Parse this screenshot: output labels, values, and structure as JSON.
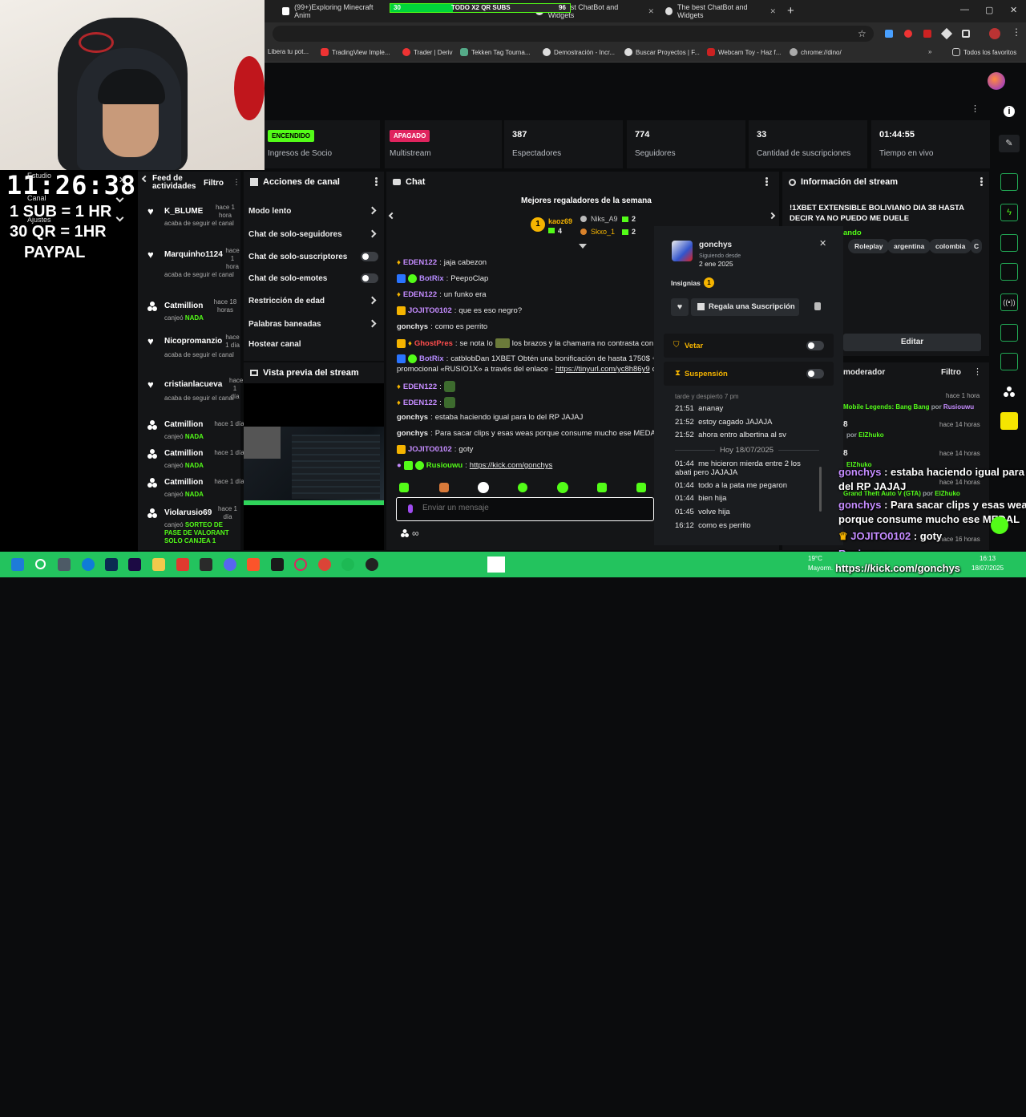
{
  "browser": {
    "tabs": [
      {
        "label": "(99+)Exploring Minecraft Anim"
      },
      {
        "label": "The best ChatBot and Widgets"
      },
      {
        "label": "The best ChatBot and Widgets"
      }
    ],
    "bookmarks": [
      "Libera tu pot...",
      "TradingView Imple...",
      "Trader | Deriv",
      "Tekken Tag Tourna...",
      "Demostración - Incr...",
      "Buscar Proyectos | F...",
      "Webcam Toy - Haz f...",
      "chrome://dino/",
      "Todos los favoritos"
    ]
  },
  "stats": [
    {
      "badge": "ENCENDIDO",
      "label": "Ingresos de Socio"
    },
    {
      "badge": "APAGADO",
      "label": "Multistream"
    },
    {
      "value": "387",
      "label": "Espectadores"
    },
    {
      "value": "774",
      "label": "Seguidores"
    },
    {
      "value": "33",
      "label": "Cantidad de suscripciones"
    },
    {
      "value": "01:44:55",
      "label": "Tiempo en vivo"
    }
  ],
  "feed": {
    "title": "Feed de actividades",
    "filter": "Filtro",
    "items": [
      {
        "name": "K_BLUME",
        "time": "hace 1 hora",
        "desc": "acaba de seguir el canal"
      },
      {
        "name": "Marquinho1124",
        "time": "hace 1 hora",
        "desc": "acaba de seguir el canal"
      },
      {
        "name": "Catmillion",
        "time": "hace 18 horas",
        "desc": "canjeó",
        "reward": "NADA"
      },
      {
        "name": "Nicopromanzio",
        "time": "hace 1 día",
        "desc": "acaba de seguir el canal"
      },
      {
        "name": "cristianlacueva",
        "time": "hace 1 día",
        "desc": "acaba de seguir el canal"
      },
      {
        "name": "Catmillion",
        "time": "hace 1 día",
        "desc": "canjeó",
        "reward": "NADA"
      },
      {
        "name": "Catmillion",
        "time": "hace 1 día",
        "desc": "canjeó",
        "reward": "NADA"
      },
      {
        "name": "Catmillion",
        "time": "hace 1 día",
        "desc": "canjeó",
        "reward": "NADA"
      },
      {
        "name": "Violarusio69",
        "time": "hace 1 día",
        "desc": "canjeó",
        "reward": "SORTEO DE PASE DE VALORANT SOLO CANJEA 1"
      }
    ]
  },
  "actions": {
    "title": "Acciones de canal",
    "items": [
      "Modo lento",
      "Chat de solo-seguidores",
      "Chat de solo-suscriptores",
      "Chat de solo-emotes",
      "Restricción de edad",
      "Palabras baneadas",
      "Hostear canal"
    ],
    "preview_title": "Vista previa del stream"
  },
  "chat": {
    "title": "Chat",
    "gifters_title": "Mejores regaladores de la semana",
    "gifters": [
      {
        "rank": "1",
        "name": "kaoz69",
        "count": "4"
      },
      {
        "name": "Niks_A9",
        "count": "2"
      },
      {
        "name": "Skxo_1",
        "count": "2"
      }
    ],
    "messages": [
      {
        "user": "EDEN122",
        "text": "jaja cabezon",
        "color": "#c58cff"
      },
      {
        "user": "BotRix",
        "text": "PeepoClap",
        "color": "#b68cff"
      },
      {
        "user": "EDEN122",
        "text": "un funko era",
        "color": "#c58cff"
      },
      {
        "user": "JOJITO0102",
        "text": "que es eso negro?",
        "color": "#c58cff"
      },
      {
        "user": "gonchys",
        "text": "como es perrito",
        "color": "#e8e8e8"
      },
      {
        "user": "GhostPres",
        "text": "se nota lo",
        "text2": "los brazos y la chamarra no contrasta con tu",
        "color": "#ff4d4d"
      },
      {
        "user": "BotRix",
        "text": "catblobDan 1XBET Obtén una bonificación de hasta 1750$ + 150",
        "line2": "promocional «RUSIO1X» a través del enlace -",
        "link": "https://tinyurl.com/yc8h86y9",
        "tail": "cat",
        "color": "#b68cff"
      },
      {
        "user": "EDEN122",
        "text": "",
        "color": "#c58cff"
      },
      {
        "user": "EDEN122",
        "text": "",
        "color": "#c58cff"
      },
      {
        "user": "gonchys",
        "text": "estaba haciendo igual para lo del RP JAJAJ",
        "color": "#e8e8e8"
      },
      {
        "user": "gonchys",
        "text": "Para sacar clips y esas weas porque consume mucho ese MEDAL",
        "color": "#e8e8e8"
      },
      {
        "user": "JOJITO0102",
        "text": "goty",
        "color": "#c58cff"
      },
      {
        "user": "Rusiouwu",
        "text": "",
        "link": "https://kick.com/gonchys",
        "color": "#53fc18"
      }
    ],
    "input_placeholder": "Enviar un mensaje"
  },
  "user_card": {
    "name": "gonchys",
    "following_label": "Siguiendo desde",
    "following_date": "2 ene 2025",
    "insignias_label": "Insignias",
    "insignias_count": "1",
    "gift_label": "Regala una Suscripción",
    "veto_label": "Vetar",
    "suspend_label": "Suspensión",
    "history_partial": "tarde y despierto 7 pm",
    "history": [
      {
        "time": "21:51",
        "text": "ananay"
      },
      {
        "time": "21:52",
        "text": "estoy cagado JAJAJA"
      },
      {
        "time": "21:52",
        "text": "ahora entro albertina al sv"
      },
      {
        "divider": "Hoy 18/07/2025"
      },
      {
        "time": "01:44",
        "text": "me hicieron mierda entre 2 los",
        "text2": "abati pero JAJAJA"
      },
      {
        "time": "01:44",
        "text": "todo a la pata me pegaron"
      },
      {
        "time": "01:44",
        "text": "bien hija"
      },
      {
        "time": "01:45",
        "text": "volve hija"
      },
      {
        "time": "16:12",
        "text": "como es perrito"
      }
    ]
  },
  "stream_info": {
    "title": "Información del stream",
    "stream_title": "!1XBET EXTENSIBLE BOLIVIANO DIA 38 HASTA DECIR YA NO PUEDO ME DUELE",
    "category_partial": "ando",
    "tags": [
      "Roleplay",
      "argentina",
      "colombia",
      "C"
    ],
    "edit_label": "Editar"
  },
  "mod": {
    "title": "moderador",
    "filter": "Filtro",
    "items": [
      {
        "time": "hace 1 hora",
        "text": "Mobile Legends: Bang Bang",
        "by": "por",
        "user": "Rusiouwu"
      },
      {
        "prefix": "8",
        "time": "hace 14 horas",
        "by": "por",
        "user": "ElZhuko"
      },
      {
        "prefix": "8",
        "time": "hace 14 horas",
        "user": "ElZhuko"
      },
      {
        "text": "Grand Theft Auto V (GTA)",
        "by": "por",
        "user": "ElZhuko",
        "time": "hace 14 horas"
      },
      {
        "time": "hace 16 horas"
      }
    ]
  },
  "overlay": {
    "clock": "11:26:38",
    "line1": "1 SUB = 1 HR",
    "line2": "30 QR = 1HR",
    "line3": "PAYPAL",
    "menu_items": [
      "Estudio",
      "Canal",
      "Ajustes"
    ],
    "goal_label": "TODO X2 QR SUBS",
    "goal_left": "30",
    "goal_right": "96",
    "goal_progress": 0.35,
    "chat": [
      {
        "user": "gonchys",
        "text": "estaba haciendo igual para lo",
        "text2": "del RP JAJAJ"
      },
      {
        "user": "gonchys",
        "text": "Para sacar clips y esas weas",
        "text2": "porque consume mucho ese MEDAL"
      },
      {
        "user": "JOJITO0102",
        "text": "goty"
      },
      {
        "user": "Rusiouwu",
        "text": ""
      },
      {
        "link": "https://kick.com/gonchys"
      }
    ]
  },
  "taskbar": {
    "weather_temp": "19°C",
    "weather_desc": "Mayorm.",
    "time": "16:13",
    "date": "18/07/2025"
  }
}
